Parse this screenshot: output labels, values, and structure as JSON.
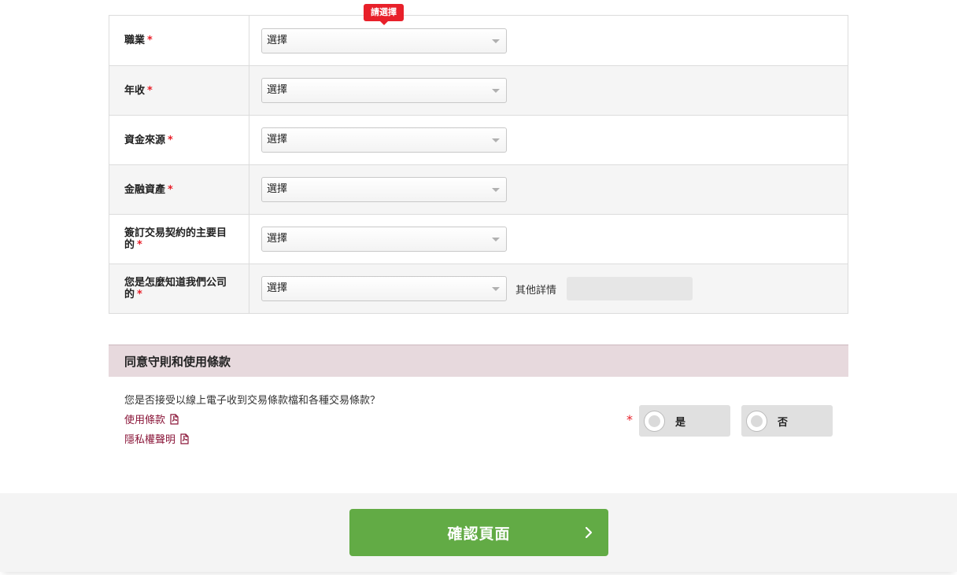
{
  "tooltip": "請選擇",
  "rows": [
    {
      "label": "職業",
      "required_mark": "*",
      "select_value": "選擇"
    },
    {
      "label": "年收",
      "required_mark": "*",
      "select_value": "選擇"
    },
    {
      "label": "資金來源",
      "required_mark": "*",
      "select_value": "選擇"
    },
    {
      "label": "金融資產",
      "required_mark": "*",
      "select_value": "選擇"
    },
    {
      "label": "簽訂交易契約的主要目的",
      "required_mark": "*",
      "select_value": "選擇"
    },
    {
      "label": "您是怎麼知道我們公司的",
      "required_mark": "*",
      "select_value": "選擇",
      "other_label": "其他詳情",
      "other_value": ""
    }
  ],
  "terms": {
    "header": "同意守則和使用條款",
    "question": "您是否接受以線上電子收到交易條款檔和各種交易條款？",
    "links": [
      {
        "label": "使用條款",
        "icon": "pdf-icon"
      },
      {
        "label": "隱私權聲明",
        "icon": "pdf-icon"
      }
    ],
    "required_mark": "*",
    "options": [
      {
        "label": "是"
      },
      {
        "label": "否"
      }
    ]
  },
  "confirm_button": {
    "label": "確認頁面",
    "icon": "chevron-right-icon"
  },
  "colors": {
    "required": "#e8202a",
    "accent_green": "#62ab45",
    "link": "#8a1538",
    "section_header_bg": "#e7d9dd"
  }
}
